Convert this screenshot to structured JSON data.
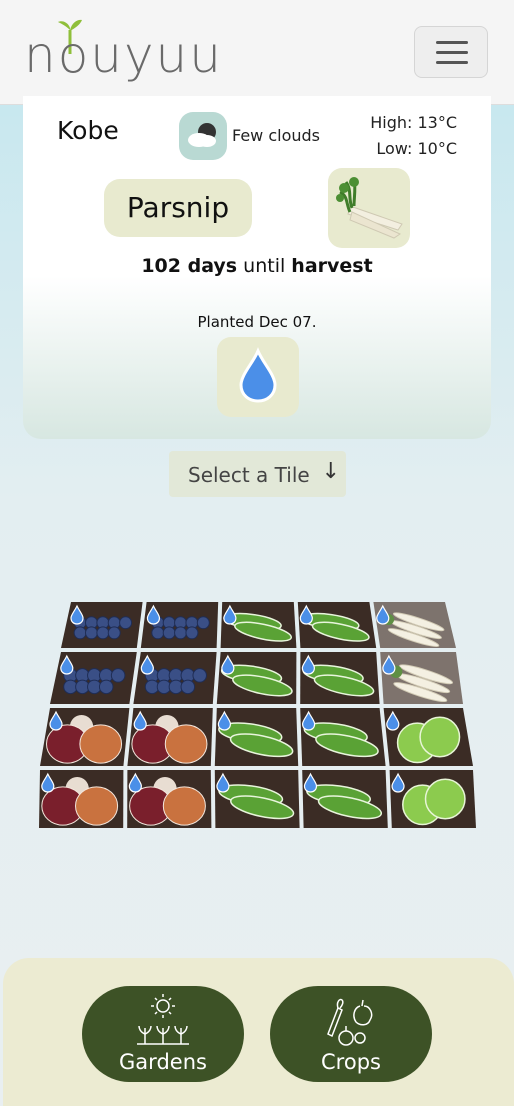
{
  "header": {
    "logo_text": "nouyuu",
    "menu_icon": "hamburger-menu-icon"
  },
  "weather": {
    "city": "Kobe",
    "condition": "Few clouds",
    "high": "High: 13°C",
    "low": "Low: 10°C",
    "icon": "few-clouds-icon"
  },
  "crop": {
    "name": "Parsnip",
    "days": "102 days",
    "until_text": " until ",
    "harvest": "harvest",
    "planted": "Planted Dec 07.",
    "image_icon": "parsnip-icon",
    "water_icon": "water-drop-icon"
  },
  "select": {
    "label": "Select a Tile",
    "arrow": "↓"
  },
  "tiles": [
    [
      "blueberry",
      "blueberry",
      "peas",
      "peas",
      "parsnip"
    ],
    [
      "blueberry",
      "blueberry",
      "peas",
      "peas",
      "parsnip"
    ],
    [
      "onion",
      "onion",
      "peas",
      "peas",
      "lettuce"
    ],
    [
      "onion",
      "onion",
      "peas",
      "peas",
      "lettuce"
    ]
  ],
  "nav": {
    "gardens": "Gardens",
    "crops": "Crops"
  },
  "colors": {
    "nav_green": "#3d5226",
    "pill_bg": "#e8eacf",
    "drop_blue": "#4b8fe8"
  }
}
